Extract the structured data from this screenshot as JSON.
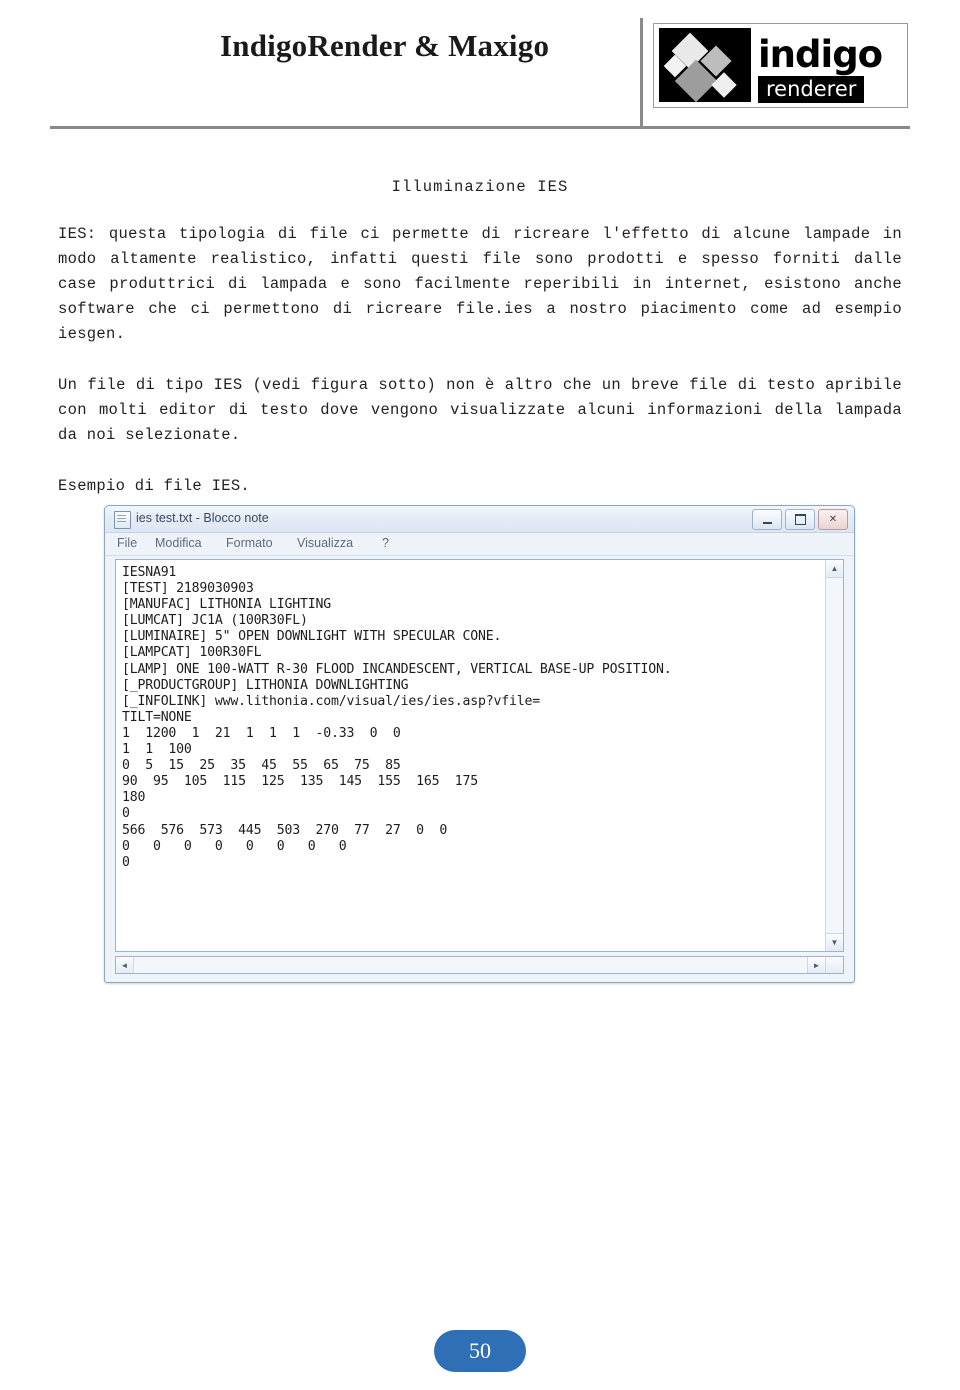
{
  "header": {
    "title": "IndigoRender & Maxigo",
    "logo_name": "indigo",
    "logo_sub": "renderer"
  },
  "document": {
    "section_title": "Illuminazione IES",
    "paragraph_1": "IES: questa tipologia di file ci permette di ricreare l'effetto di alcune lampade in modo altamente realistico, infatti questi file  sono prodotti e spesso forniti dalle case produttrici di lampada e sono facilmente reperibili in internet, esistono anche software che ci permettono di ricreare file.ies a nostro piacimento come ad esempio iesgen.",
    "paragraph_2": "Un file di tipo IES (vedi figura sotto) non è altro che un breve file di testo apribile con molti editor di testo dove vengono visualizzate alcuni informazioni della lampada da noi selezionate.",
    "paragraph_3": "Esempio di file IES.",
    "page_number": "50"
  },
  "notepad": {
    "title": "ies test.txt - Blocco note",
    "menu": [
      "File",
      "Modifica",
      "Formato",
      "Visualizza",
      "?"
    ],
    "buttons": {
      "minimize": "minimize-button",
      "maximize": "maximize-button",
      "close": "✕"
    },
    "content": "IESNA91\n[TEST] 2189030903\n[MANUFAC] LITHONIA LIGHTING\n[LUMCAT] JC1A (100R30FL)\n[LUMINAIRE] 5\" OPEN DOWNLIGHT WITH SPECULAR CONE.\n[LAMPCAT] 100R30FL\n[LAMP] ONE 100-WATT R-30 FLOOD INCANDESCENT, VERTICAL BASE-UP POSITION.\n[_PRODUCTGROUP] LITHONIA DOWNLIGHTING\n[_INFOLINK] www.lithonia.com/visual/ies/ies.asp?vfile=\nTILT=NONE\n1  1200  1  21  1  1  1  -0.33  0  0\n1  1  100\n0  5  15  25  35  45  55  65  75  85\n90  95  105  115  125  135  145  155  165  175\n180\n0\n566  576  573  445  503  270  77  27  0  0\n0   0   0   0   0   0   0   0\n0",
    "scroll": {
      "up": "▲",
      "down": "▼",
      "left": "◄",
      "right": "►"
    }
  }
}
